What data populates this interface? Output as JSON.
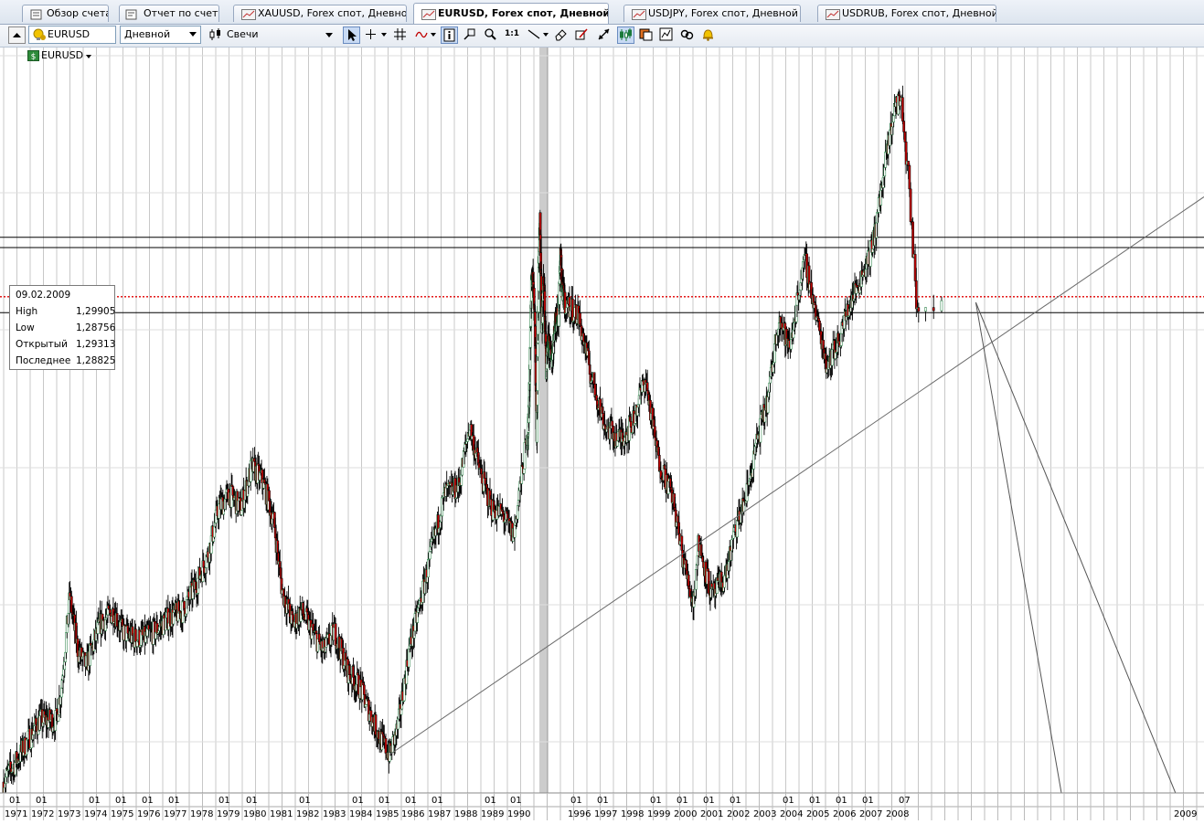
{
  "tabs": [
    {
      "label": "Обзор счета",
      "icon": "account-overview-icon"
    },
    {
      "label": "Отчет по счету",
      "icon": "account-report-icon"
    },
    {
      "label": "XAUUSD, Forex спот, Дневной",
      "icon": "chart-tab-icon"
    },
    {
      "label": "EURUSD, Forex спот, Дневной",
      "icon": "chart-tab-icon",
      "active": true
    },
    {
      "label": "USDJPY, Forex спот, Дневной",
      "icon": "chart-tab-icon"
    },
    {
      "label": "USDRUB, Forex спот, Дневной",
      "icon": "chart-tab-icon"
    }
  ],
  "toolbar": {
    "symbol": "EURUSD",
    "timeframe": "Дневной",
    "chart_type": "Свечи",
    "zoom_one_to_one": "1:1",
    "tools": [
      "collapse-up-icon",
      "cursor-icon",
      "crosshair-icon",
      "dropdown-icon",
      "grid-icon",
      "indicator-icon",
      "dropdown-icon",
      "info-icon",
      "zoom-area-icon",
      "magnifier-icon",
      "line-tool-icon",
      "dropdown-icon",
      "eraser-icon",
      "draw-icon",
      "autoscale-icon",
      "candles-icon",
      "template-icon",
      "objects-icon",
      "link-icon",
      "alert-bell-icon"
    ]
  },
  "instrument_label": "EURUSD",
  "tooltip": {
    "date": "09.02.2009",
    "rows": [
      {
        "label": "High",
        "value": "1,29905"
      },
      {
        "label": "Low",
        "value": "1,28756"
      },
      {
        "label": "Открытый",
        "value": "1,29313"
      },
      {
        "label": "Последнее",
        "value": "1,28825"
      }
    ]
  },
  "colors": {
    "bull_candle": "#1a7a3a",
    "bear_candle": "#c00000",
    "wick": "#000000",
    "grid": "#c8c8c8",
    "level_line": "#000000",
    "current_price_line": "#e00000",
    "trendline": "#6b6b6b"
  },
  "chart_data": {
    "type": "candlestick",
    "x_tick_labels_month": [
      "01",
      "01",
      "01",
      "01",
      "01",
      "01",
      "01",
      "01",
      "01",
      "01",
      "01",
      "01",
      "01",
      "01",
      "01",
      "01",
      "01",
      "01",
      "01",
      "01",
      "01",
      "01",
      "01",
      "01",
      "01",
      "01",
      "01",
      "01",
      "07"
    ],
    "x_tick_labels_year": [
      "1971",
      "1972",
      "1973",
      "1974",
      "1975",
      "1976",
      "1977",
      "1978",
      "1979",
      "1980",
      "1981",
      "1982",
      "1983",
      "1984",
      "1985",
      "1986",
      "1987",
      "1988",
      "1989",
      "1990",
      "1996",
      "1997",
      "1998",
      "1999",
      "2000",
      "2001",
      "2002",
      "2003",
      "2004",
      "2005",
      "2006",
      "2007",
      "2008",
      "2009"
    ],
    "price_path": [
      [
        1971.0,
        0.58
      ],
      [
        1971.6,
        0.62
      ],
      [
        1972.3,
        0.67
      ],
      [
        1972.9,
        0.67
      ],
      [
        1973.1,
        0.72
      ],
      [
        1973.4,
        0.85
      ],
      [
        1973.7,
        0.77
      ],
      [
        1974.0,
        0.75
      ],
      [
        1974.5,
        0.81
      ],
      [
        1975.0,
        0.83
      ],
      [
        1975.3,
        0.8
      ],
      [
        1975.7,
        0.79
      ],
      [
        1976.1,
        0.79
      ],
      [
        1976.5,
        0.8
      ],
      [
        1977.0,
        0.82
      ],
      [
        1977.5,
        0.83
      ],
      [
        1978.0,
        0.87
      ],
      [
        1978.4,
        0.91
      ],
      [
        1978.8,
        0.98
      ],
      [
        1979.2,
        1.0
      ],
      [
        1979.6,
        0.98
      ],
      [
        1980.0,
        1.04
      ],
      [
        1980.4,
        1.02
      ],
      [
        1980.8,
        0.96
      ],
      [
        1981.1,
        0.86
      ],
      [
        1981.5,
        0.81
      ],
      [
        1981.8,
        0.83
      ],
      [
        1982.2,
        0.8
      ],
      [
        1982.6,
        0.77
      ],
      [
        1983.0,
        0.8
      ],
      [
        1983.5,
        0.74
      ],
      [
        1983.9,
        0.72
      ],
      [
        1984.3,
        0.68
      ],
      [
        1984.7,
        0.64
      ],
      [
        1985.0,
        0.62
      ],
      [
        1985.3,
        0.66
      ],
      [
        1985.7,
        0.77
      ],
      [
        1986.1,
        0.84
      ],
      [
        1986.6,
        0.93
      ],
      [
        1987.0,
        1.0
      ],
      [
        1987.5,
        1.01
      ],
      [
        1987.9,
        1.1
      ],
      [
        1988.3,
        1.03
      ],
      [
        1988.7,
        0.98
      ],
      [
        1989.1,
        0.97
      ],
      [
        1989.5,
        0.94
      ],
      [
        1989.9,
        1.06
      ],
      [
        1990.3,
        1.13
      ],
      [
        1990.7,
        1.3
      ],
      [
        1991.0,
        1.32
      ],
      [
        1991.3,
        1.26
      ],
      [
        1991.6,
        1.08
      ],
      [
        1991.9,
        1.34
      ],
      [
        1992.1,
        1.4
      ],
      [
        1992.4,
        1.24
      ],
      [
        1992.7,
        1.32
      ],
      [
        1993.1,
        1.18
      ],
      [
        1993.4,
        1.22
      ],
      [
        1994.0,
        1.2
      ],
      [
        1994.5,
        1.25
      ],
      [
        1995.0,
        1.26
      ],
      [
        1995.3,
        1.35
      ],
      [
        1995.6,
        1.3
      ],
      [
        1996.0,
        1.28
      ],
      [
        1996.5,
        1.26
      ],
      [
        1997.0,
        1.17
      ],
      [
        1997.5,
        1.1
      ],
      [
        1998.0,
        1.08
      ],
      [
        1998.5,
        1.1
      ],
      [
        1999.0,
        1.17
      ],
      [
        1999.5,
        1.05
      ],
      [
        2000.0,
        1.0
      ],
      [
        2000.4,
        0.91
      ],
      [
        2000.8,
        0.84
      ],
      [
        2001.0,
        0.93
      ],
      [
        2001.5,
        0.85
      ],
      [
        2002.0,
        0.88
      ],
      [
        2002.4,
        0.95
      ],
      [
        2002.8,
        1.0
      ],
      [
        2003.2,
        1.08
      ],
      [
        2003.6,
        1.14
      ],
      [
        2004.0,
        1.26
      ],
      [
        2004.4,
        1.21
      ],
      [
        2004.8,
        1.31
      ],
      [
        2005.0,
        1.34
      ],
      [
        2005.4,
        1.26
      ],
      [
        2005.8,
        1.19
      ],
      [
        2006.2,
        1.22
      ],
      [
        2006.6,
        1.27
      ],
      [
        2007.0,
        1.31
      ],
      [
        2007.5,
        1.36
      ],
      [
        2007.9,
        1.46
      ],
      [
        2008.3,
        1.56
      ],
      [
        2008.55,
        1.58
      ],
      [
        2008.75,
        1.46
      ],
      [
        2008.95,
        1.27
      ],
      [
        2009.1,
        1.29
      ]
    ],
    "horizontal_levels": [
      1.375,
      1.36,
      1.265
    ],
    "current_price": 1.28825,
    "trendline": [
      [
        1985.0,
        0.62
      ],
      [
        2009.6,
        1.32
      ]
    ],
    "projection_lines": [
      [
        2009.2,
        1.28
      ],
      [
        2009.5,
        -0.15
      ],
      [
        2009.9,
        -0.15
      ]
    ]
  }
}
